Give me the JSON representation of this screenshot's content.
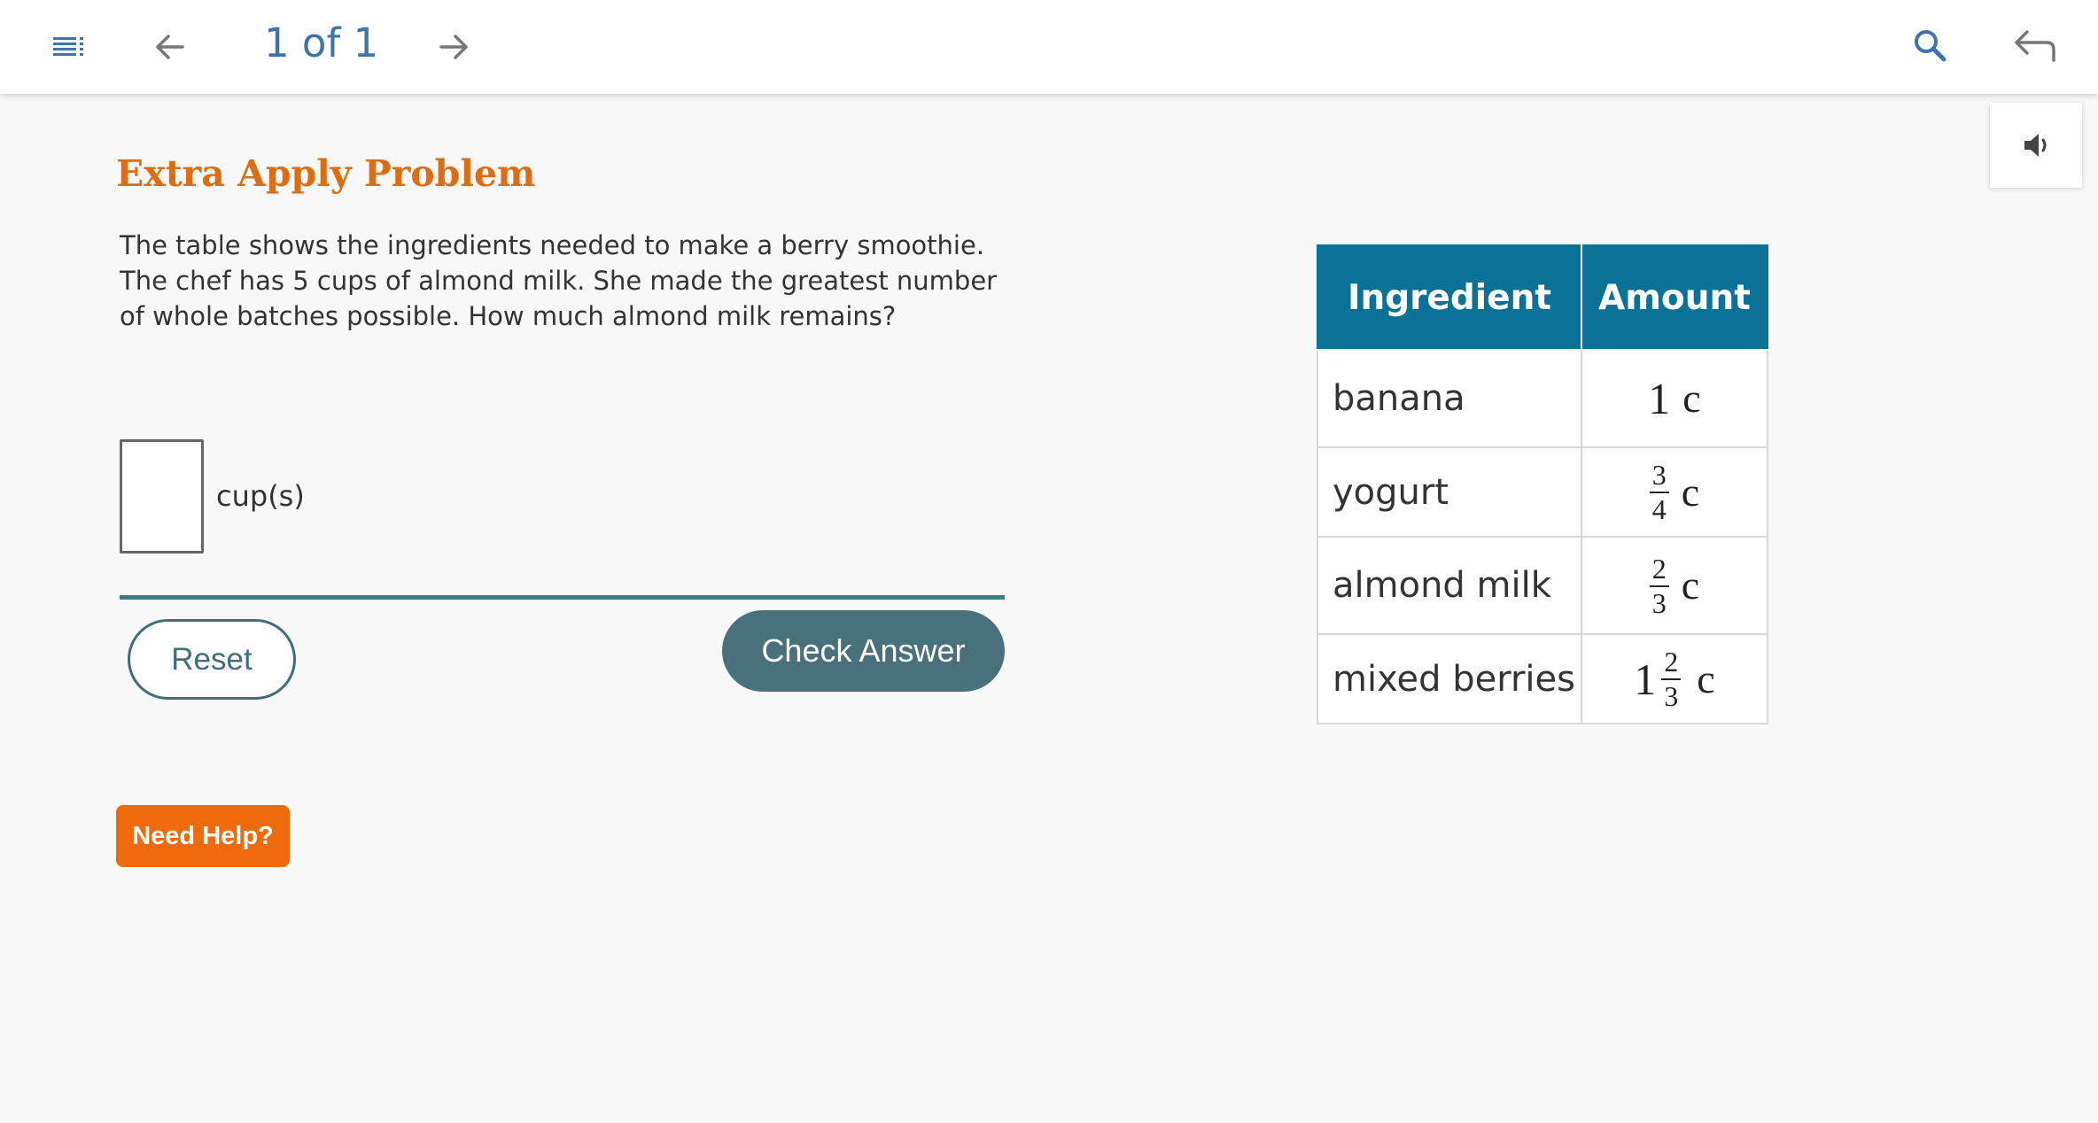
{
  "nav": {
    "menu_icon": "menu-list-icon",
    "prev_icon": "arrow-left-icon",
    "pager_text": "1 of 1",
    "next_icon": "arrow-right-icon",
    "search_icon": "search-icon",
    "back_icon": "return-arrow-icon"
  },
  "audio": {
    "icon": "speaker-icon"
  },
  "problem": {
    "title": "Extra Apply Problem",
    "prompt": "The table shows the ingredients needed to make a berry smoothie. The chef has 5 cups of almond milk. She made the greatest number of whole batches possible. How much almond milk remains?",
    "answer_value": "",
    "unit_label": "cup(s)"
  },
  "buttons": {
    "reset": "Reset",
    "check": "Check Answer",
    "help": "Need Help?"
  },
  "table": {
    "headers": [
      "Ingredient",
      "Amount"
    ],
    "rows": [
      {
        "ingredient": "banana",
        "whole": "1",
        "num": "",
        "den": "",
        "unit": "c"
      },
      {
        "ingredient": "yogurt",
        "whole": "",
        "num": "3",
        "den": "4",
        "unit": "c"
      },
      {
        "ingredient": "almond milk",
        "whole": "",
        "num": "2",
        "den": "3",
        "unit": "c"
      },
      {
        "ingredient": "mixed berries",
        "whole": "1",
        "num": "2",
        "den": "3",
        "unit": "c"
      }
    ]
  },
  "colors": {
    "title_orange": "#e06c12",
    "header_teal": "#0c7196",
    "check_button": "#4a707c",
    "help_button": "#ee6a0c",
    "pager_blue": "#3d74ad",
    "divider": "#3e7b80"
  }
}
